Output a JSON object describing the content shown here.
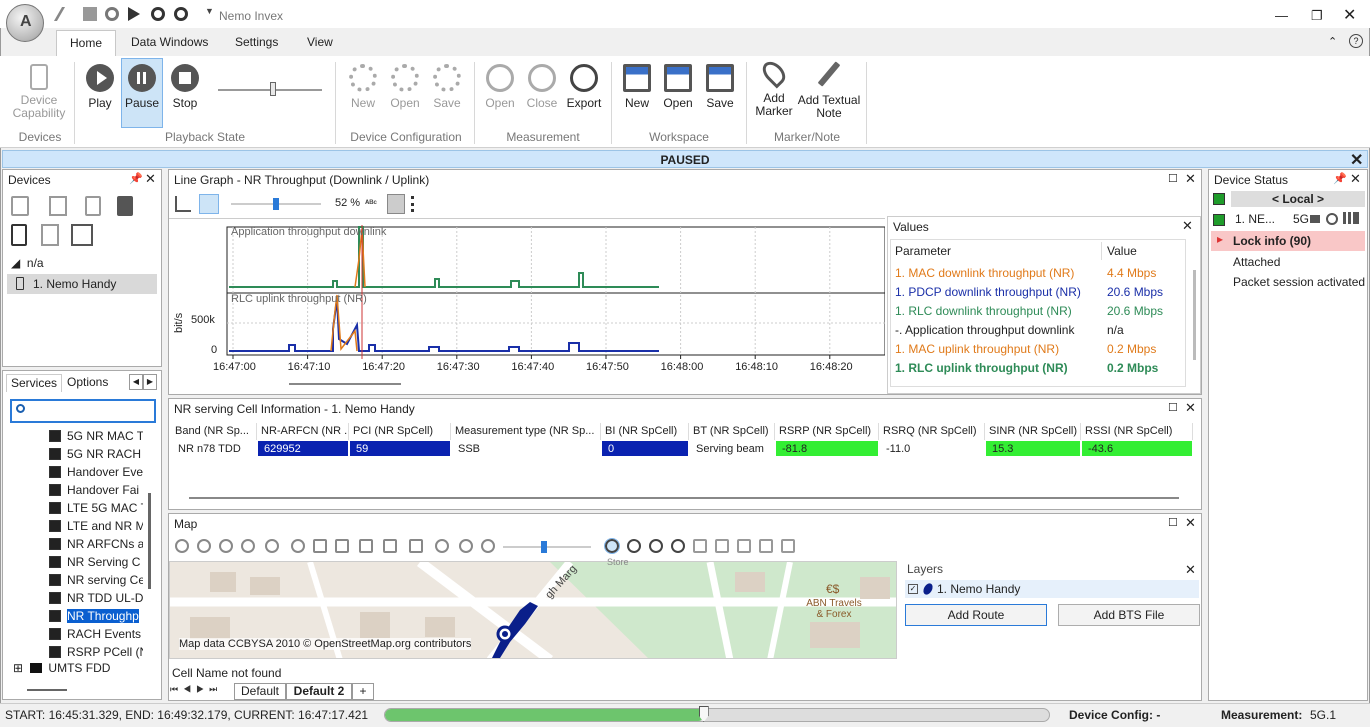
{
  "app": {
    "title": "Nemo Invex"
  },
  "ribbon": {
    "tabs": [
      "Home",
      "Data Windows",
      "Settings",
      "View"
    ],
    "devices": {
      "device_capability": "Device\nCapability",
      "group": "Devices"
    },
    "playback": {
      "play": "Play",
      "pause": "Pause",
      "stop": "Stop",
      "group": "Playback State"
    },
    "device_config": {
      "new": "New",
      "open": "Open",
      "save": "Save",
      "group": "Device Configuration"
    },
    "measurement": {
      "open": "Open",
      "close": "Close",
      "export": "Export",
      "group": "Measurement"
    },
    "workspace": {
      "new": "New",
      "open": "Open",
      "save": "Save",
      "group": "Workspace"
    },
    "marker": {
      "add_marker": "Add\nMarker",
      "add_note": "Add Textual\nNote",
      "group": "Marker/Note"
    }
  },
  "banner": {
    "paused": "PAUSED"
  },
  "devices_panel": {
    "title": "Devices",
    "root": "n/a",
    "device": "1. Nemo Handy"
  },
  "services_panel": {
    "tabs": [
      "Services",
      "Options"
    ],
    "search_placeholder": "",
    "items": [
      "5G NR MAC T",
      "5G NR RACH",
      "Handover Eve",
      "Handover Fai",
      "LTE 5G MAC T",
      "LTE and NR M",
      "NR ARFCNs a",
      "NR Serving C",
      "NR serving Ce",
      "NR TDD UL-D",
      "NR Throughp",
      "RACH Events",
      "RSRP PCell (N"
    ],
    "selected": "NR Throughp",
    "folder": "UMTS FDD"
  },
  "line_graph": {
    "title": "Line Graph - NR Throughput (Downlink / Uplink)",
    "zoom": "52 %",
    "top_label": "Application throughput downlink",
    "bottom_label": "RLC uplink throughput (NR)",
    "y_unit": "bit/s",
    "y_ticks": [
      "500k",
      "0"
    ],
    "x_ticks": [
      "16:47:00",
      "16:47:10",
      "16:47:20",
      "16:47:30",
      "16:47:40",
      "16:47:50",
      "16:48:00",
      "16:48:10",
      "16:48:20"
    ]
  },
  "values_panel": {
    "title": "Values",
    "col_param": "Parameter",
    "col_value": "Value",
    "rows": [
      {
        "param": "1. MAC downlink throughput (NR)",
        "value": "4.4 Mbps",
        "color": "#e07a1a",
        "bold": false
      },
      {
        "param": "1. PDCP downlink throughput (NR)",
        "value": "20.6 Mbps",
        "color": "#1a2fa8",
        "bold": false
      },
      {
        "param": "1. RLC downlink throughput (NR)",
        "value": "20.6 Mbps",
        "color": "#2e8b57",
        "bold": false
      },
      {
        "param": "-. Application throughput downlink",
        "value": "n/a",
        "color": "#222222",
        "bold": false
      },
      {
        "param": "1. MAC uplink throughput (NR)",
        "value": "0.2 Mbps",
        "color": "#e07a1a",
        "bold": false
      },
      {
        "param": "1. RLC uplink throughput (NR)",
        "value": "0.2 Mbps",
        "color": "#2e8b57",
        "bold": true
      }
    ]
  },
  "cell_info": {
    "title": "NR serving Cell Information - 1. Nemo Handy",
    "headers": [
      "Band (NR Sp...",
      "NR-ARFCN (NR ...",
      "PCI (NR SpCell)",
      "Measurement type (NR Sp...",
      "BI (NR SpCell)",
      "BT (NR SpCell)",
      "RSRP (NR SpCell)",
      "RSRQ (NR SpCell)",
      "SINR (NR SpCell)",
      "RSSI (NR SpCell)"
    ],
    "values": [
      "NR n78 TDD",
      "629952",
      "59",
      "SSB",
      "0",
      "Serving beam",
      "-81.8",
      "-11.0",
      "15.3",
      "-43.6"
    ]
  },
  "map": {
    "title": "Map",
    "road_label": "gh Marg",
    "poi": "ABN Travels\n& Forex",
    "store": "Store",
    "attribution": "Map data CCBYSA 2010 © OpenStreetMap.org contributors",
    "cell_name": "Cell Name not found",
    "layers_title": "Layers",
    "layer_item": "1. Nemo Handy",
    "add_route": "Add Route",
    "add_bts": "Add BTS File"
  },
  "sheet_tabs": [
    "Default",
    "Default 2",
    "+"
  ],
  "device_status": {
    "title": "Device Status",
    "local": "< Local >",
    "device": "1. NE...",
    "tech": "5G",
    "lock_info": "Lock info (90)",
    "attached": "Attached",
    "packet": "Packet session activated"
  },
  "statusbar": {
    "time": "START: 16:45:31.329, END: 16:49:32.179, CURRENT: 16:47:17.421",
    "progress": 0.48,
    "device_config": "Device Config: -",
    "measurement_label": "Measurement:",
    "measurement_value": "5G.1"
  }
}
